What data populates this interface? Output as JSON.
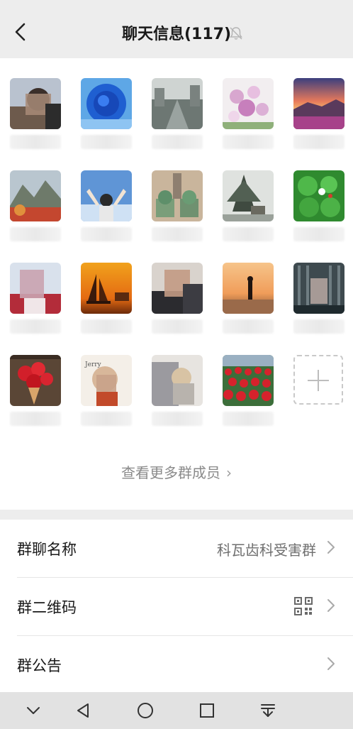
{
  "header": {
    "title": "聊天信息(117)",
    "back_icon": "chevron-left-icon",
    "mute_icon": "bell-off-icon"
  },
  "members": {
    "more_label": "查看更多群成员",
    "more_chevron": "›",
    "add_icon": "plus-icon"
  },
  "settings": {
    "group_name_label": "群聊名称",
    "group_name_value": "科瓦齿科受害群",
    "qr_label": "群二维码",
    "qr_icon": "qr-code-icon",
    "announcement_label": "群公告"
  },
  "navigation": {
    "collapse_icon": "chevron-down-icon",
    "back_icon": "triangle-back-icon",
    "home_icon": "circle-home-icon",
    "recents_icon": "square-recents-icon",
    "notifications_icon": "pull-down-icon"
  },
  "colors": {
    "page_bg": "#ededed",
    "card_bg": "#ffffff",
    "primary_text": "#191919",
    "secondary_text": "#8a8a8a"
  }
}
